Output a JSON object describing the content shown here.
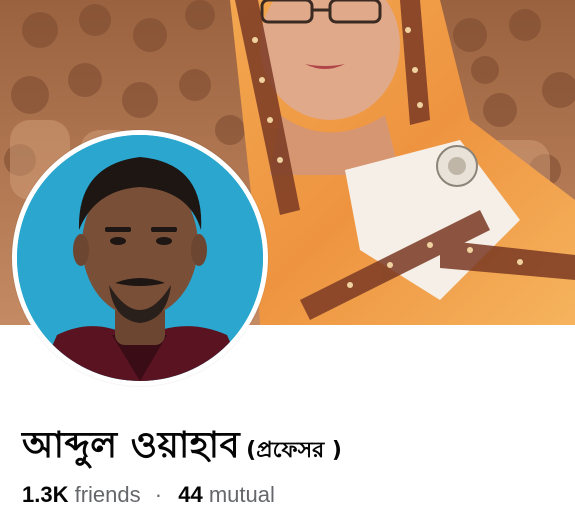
{
  "profile": {
    "name": "আব্দুল ওয়াহাব",
    "name_suffix": "(প্রফেসর )",
    "friends_count": "1.3K",
    "friends_label": "friends",
    "separator": "·",
    "mutual_count": "44",
    "mutual_label": "mutual"
  },
  "colors": {
    "cover_tone": "#b47a55",
    "saree_orange": "#f0a04b",
    "avatar_background": "#2aa6cf",
    "shirt_maroon": "#5a1320",
    "name_text": "#050505",
    "meta_text": "#65676b"
  }
}
